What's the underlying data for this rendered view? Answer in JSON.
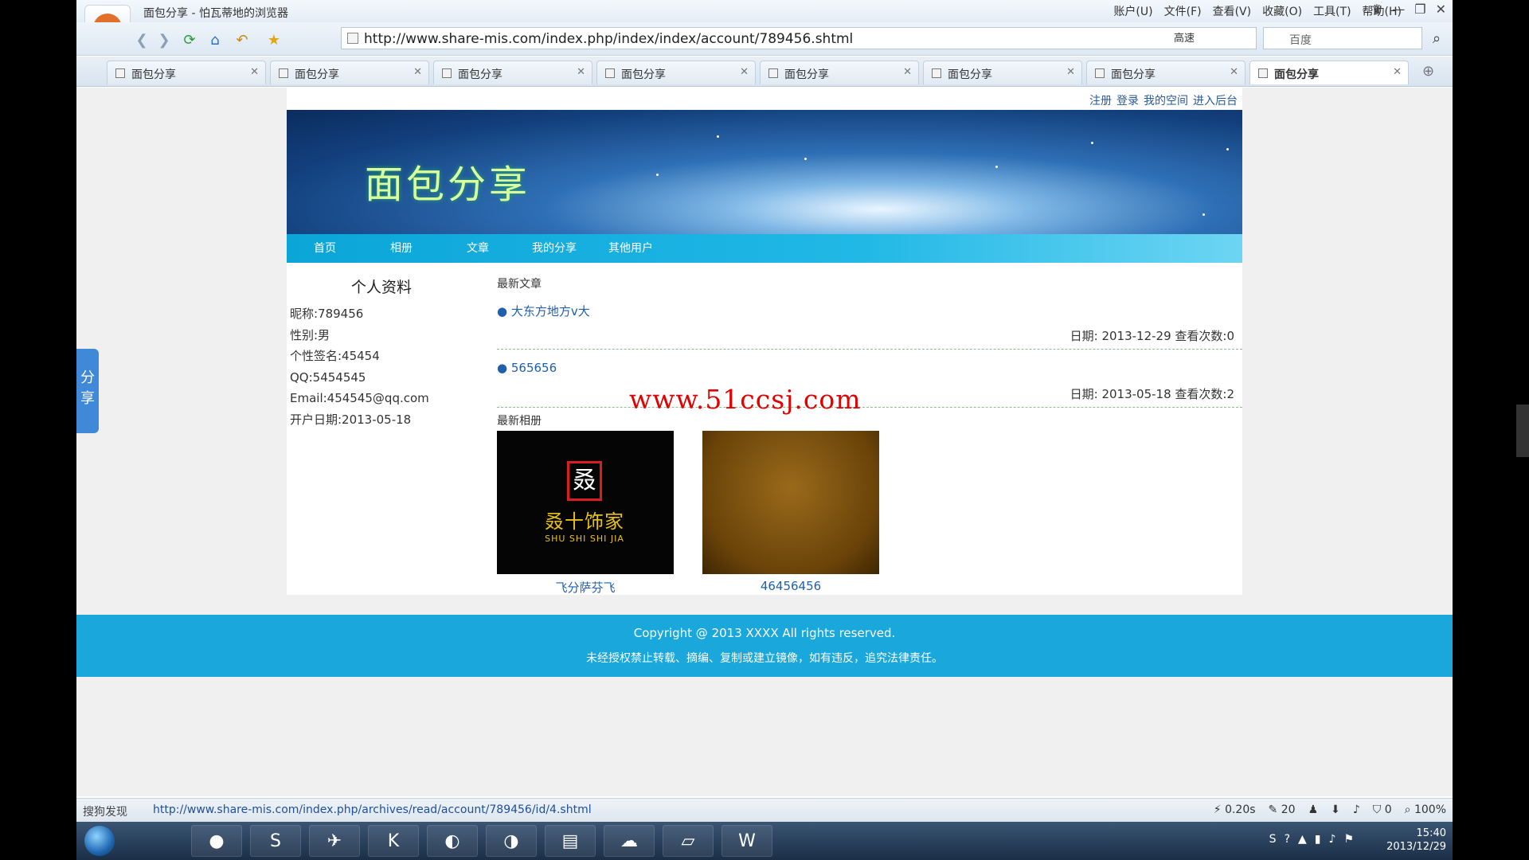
{
  "browser": {
    "title": "面包分享 - 怕瓦蒂地的浏览器",
    "menu": [
      "账户(U)",
      "文件(F)",
      "查看(V)",
      "收藏(O)",
      "工具(T)",
      "帮助(H)"
    ],
    "url": "http://www.share-mis.com/index.php/index/index/account/789456.shtml",
    "speed_label": "高速",
    "search_placeholder": "百度",
    "tabs": [
      "面包分享",
      "面包分享",
      "面包分享",
      "面包分享",
      "面包分享",
      "面包分享",
      "面包分享",
      "面包分享"
    ]
  },
  "site": {
    "top_links": [
      "注册",
      "登录",
      "我的空间",
      "进入后台"
    ],
    "logo": "面包分享",
    "nav": [
      "首页",
      "相册",
      "文章",
      "我的分享",
      "其他用户"
    ],
    "profile": {
      "title": "个人资料",
      "nickname": "昵称:789456",
      "gender": "性别:男",
      "signature": "个性签名:45454",
      "qq": "QQ:5454545",
      "email": "Email:454545@qq.com",
      "opened": "开户日期:2013-05-18"
    },
    "articles_title": "最新文章",
    "articles": [
      {
        "title": "大东方地方v大",
        "meta": "日期: 2013-12-29 查看次数:0"
      },
      {
        "title": "565656",
        "meta": "日期: 2013-05-18 查看次数:2"
      }
    ],
    "watermark": "www.51ccsj.com",
    "album_title": "最新相册",
    "photos": [
      {
        "caption": "飞分萨芬飞",
        "sign_char": "叒",
        "sign_cn": "叒十饰家",
        "sign_en": "SHU SHI SHI JIA"
      },
      {
        "caption": "46456456"
      }
    ],
    "footer": {
      "copyright": "Copyright @ 2013 XXXX All rights reserved.",
      "notice": "未经授权禁止转载、摘编、复制或建立镜像，如有违反，追究法律责任。"
    },
    "share_tab": "分享"
  },
  "status": {
    "discover": "搜狗发现",
    "link": "http://www.share-mis.com/index.php/archives/read/account/789456/id/4.shtml",
    "load_time": "0.20s",
    "count": "20",
    "blocked": "0",
    "zoom": "100%"
  },
  "taskbar": {
    "time": "15:40",
    "date": "2013/12/29"
  }
}
